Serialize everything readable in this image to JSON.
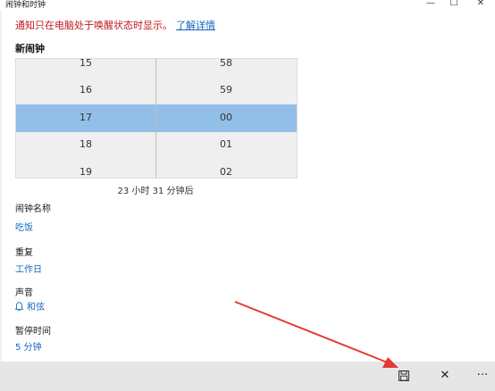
{
  "window": {
    "title": "闹钟和时钟",
    "minimize_glyph": "—",
    "maximize_glyph": "☐",
    "close_glyph": "✕"
  },
  "notice": {
    "text": "通知只在电脑处于唤醒状态时显示。",
    "link": "了解详情"
  },
  "section_title": "新闹钟",
  "picker": {
    "hours": [
      "15",
      "16",
      "17",
      "18",
      "19"
    ],
    "minutes": [
      "58",
      "59",
      "00",
      "01",
      "02"
    ],
    "selected_hour": "17",
    "selected_minute": "00"
  },
  "time_until": "23 小时 31 分钟后",
  "fields": {
    "name_label": "闹钟名称",
    "name_value": "吃饭",
    "repeat_label": "重复",
    "repeat_value": "工作日",
    "sound_label": "声音",
    "sound_value": "和弦",
    "snooze_label": "暂停时间",
    "snooze_value": "5 分钟"
  },
  "commandbar": {
    "save_icon": "save-icon",
    "close_glyph": "✕",
    "more_glyph": "···"
  },
  "colors": {
    "accent": "#1565c0",
    "selected": "#92bfe7",
    "warning": "#c0181b",
    "arrow": "#e53935"
  }
}
